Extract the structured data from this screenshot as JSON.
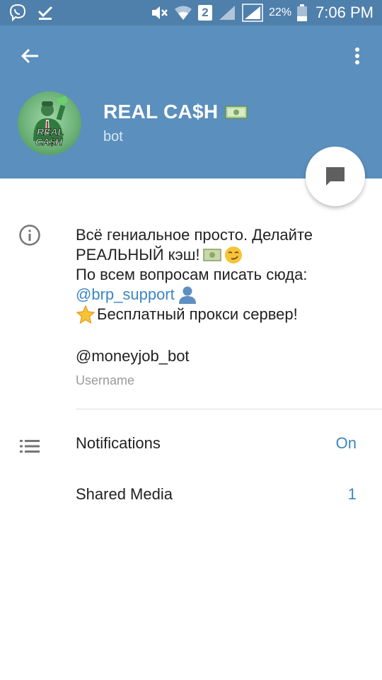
{
  "status_bar": {
    "sim": "2",
    "battery_percent": "22%",
    "time": "7:06 PM",
    "icons": [
      "viber-icon",
      "check-icon",
      "mute-icon",
      "wifi-icon",
      "signal-icon",
      "signal-icon",
      "battery-icon"
    ]
  },
  "header": {
    "title": "REAL CA$H",
    "title_emoji": "money-icon",
    "subtitle": "bot",
    "background": "#5b8fbd"
  },
  "avatar": {
    "text_top": "REAL",
    "text_bottom": "CA$H"
  },
  "about": {
    "line1": "Всё гениальное просто. Делайте",
    "line2": "РЕАЛЬНЫЙ кэш!",
    "line3": "По всем вопросам писать сюда:",
    "link": "@brp_support",
    "line5": "Бесплатный прокси сервер!"
  },
  "username": {
    "value": "@moneyjob_bot",
    "label": "Username"
  },
  "rows": [
    {
      "label": "Notifications",
      "value": "On"
    },
    {
      "label": "Shared Media",
      "value": "1"
    }
  ],
  "colors": {
    "accent": "#3c86c2",
    "statusbar": "#4f7fab"
  }
}
